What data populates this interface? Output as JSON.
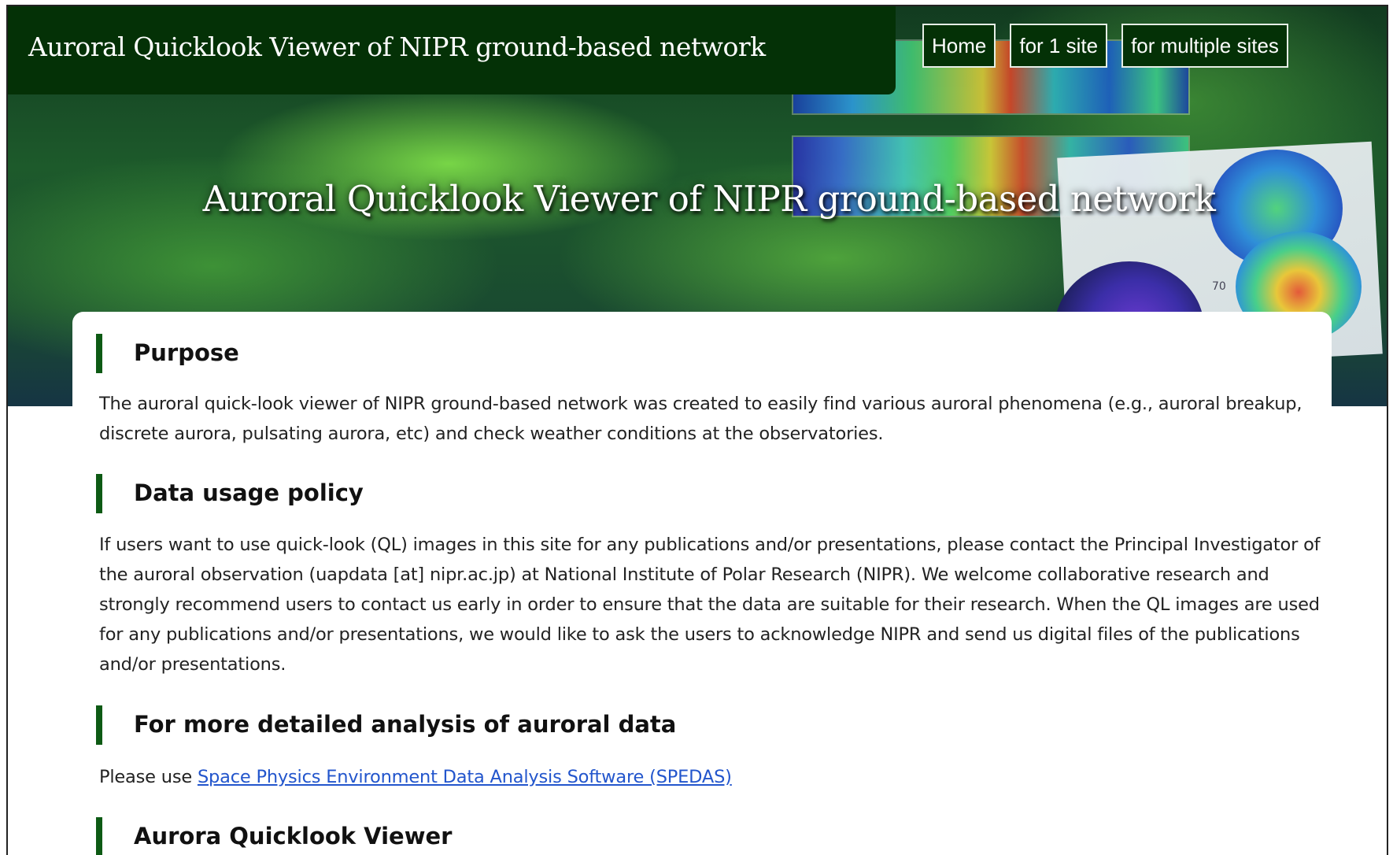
{
  "header": {
    "site_title": "Auroral Quicklook Viewer of NIPR ground-based network",
    "nav": [
      "Home",
      "for 1 site",
      "for multiple sites"
    ]
  },
  "hero": {
    "heading": "Auroral Quicklook Viewer of NIPR ground-based network",
    "map_label": "70"
  },
  "sections": {
    "purpose": {
      "title": "Purpose",
      "text": "The auroral quick-look viewer of NIPR ground-based network was created to easily find various auroral phenomena (e.g., auroral breakup, discrete aurora, pulsating aurora, etc) and check weather conditions at the observatories."
    },
    "policy": {
      "title": "Data usage policy",
      "text": "If users want to use quick-look (QL) images in this site for any publications and/or presentations, please contact the Principal Investigator of the auroral observation (uapdata [at] nipr.ac.jp) at National Institute of Polar Research (NIPR). We welcome collaborative research and strongly recommend users to contact us early in order to ensure that the data are suitable for their research. When the QL images are used for any publications and/or presentations, we would like to ask the users to acknowledge NIPR and send us digital files of the publications and/or presentations."
    },
    "analysis": {
      "title": "For more detailed analysis of auroral data",
      "prefix": "Please use ",
      "link_text": "Space Physics Environment Data Analysis Software (SPEDAS)"
    },
    "viewer": {
      "title": "Aurora Quicklook Viewer"
    }
  },
  "colors": {
    "header_bg": "#043106",
    "accent_bar": "#0d5a14",
    "link": "#2255cc"
  }
}
